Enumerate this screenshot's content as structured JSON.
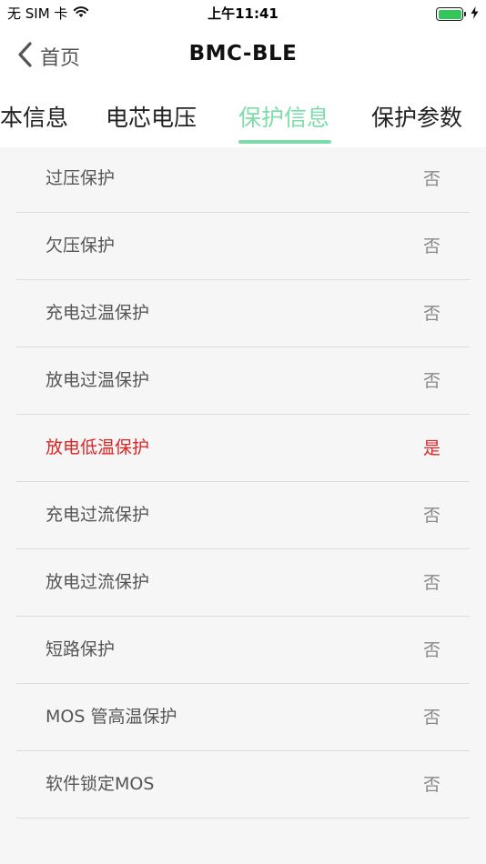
{
  "status_bar": {
    "carrier": "无 SIM 卡",
    "time": "上午11:41",
    "battery_level": 1.0
  },
  "nav": {
    "back_label": "首页",
    "title": "BMC-BLE"
  },
  "tabs": [
    {
      "label": "基本信息"
    },
    {
      "label": "电芯电压"
    },
    {
      "label": "保护信息",
      "active": true
    },
    {
      "label": "保护参数"
    }
  ],
  "protection_list": [
    {
      "label": "过压保护",
      "value": "否"
    },
    {
      "label": "欠压保护",
      "value": "否"
    },
    {
      "label": "充电过温保护",
      "value": "否"
    },
    {
      "label": "放电过温保护",
      "value": "否"
    },
    {
      "label": "放电低温保护",
      "value": "是",
      "alert": true
    },
    {
      "label": "充电过流保护",
      "value": "否"
    },
    {
      "label": "放电过流保护",
      "value": "否"
    },
    {
      "label": "短路保护",
      "value": "否"
    },
    {
      "label": "MOS 管高温保护",
      "value": "否"
    },
    {
      "label": "软件锁定MOS",
      "value": "否"
    }
  ],
  "colors": {
    "accent": "#7fdcaa",
    "alert": "#e02424",
    "battery": "#33c759"
  },
  "icons": {
    "back": "chevron-left-icon",
    "wifi": "wifi-icon",
    "battery": "battery-icon",
    "charging": "bolt-icon"
  }
}
